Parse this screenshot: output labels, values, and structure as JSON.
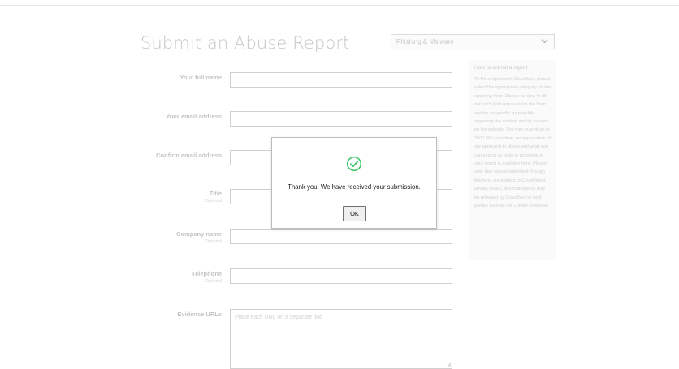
{
  "header": {
    "title": "Submit an Abuse Report"
  },
  "category_select": {
    "value": "Phishing & Malware"
  },
  "form": {
    "full_name_label": "Your full name",
    "email_label": "Your email address",
    "confirm_email_label": "Confirm email address",
    "title_label": "Title",
    "title_optional": "Optional",
    "company_label": "Company name",
    "company_optional": "Optional",
    "telephone_label": "Telephone",
    "telephone_optional": "Optional",
    "evidence_label": "Evidence URLs",
    "evidence_placeholder": "Place each URL on a separate line"
  },
  "sidebar": {
    "title": "How to submit a report",
    "text": "To file a report with Cloudflare, please select the appropriate category on the reporting form. Please be sure to fill out each field requested in the form and be as specific as possible regarding the content and its location on the website. You may submit up to 250 URLs at a time. An explanation of our approach to abuse and what you can expect us to do in response to your report is available here. Please note that reports submitted through this form are subject to Cloudflare's privacy policy, and that reports may be released by Cloudflare to third parties such as the Lumen Database."
  },
  "dialog": {
    "message": "Thank you. We have received your submission.",
    "ok_label": "OK"
  },
  "colors": {
    "success": "#3cc76b"
  }
}
